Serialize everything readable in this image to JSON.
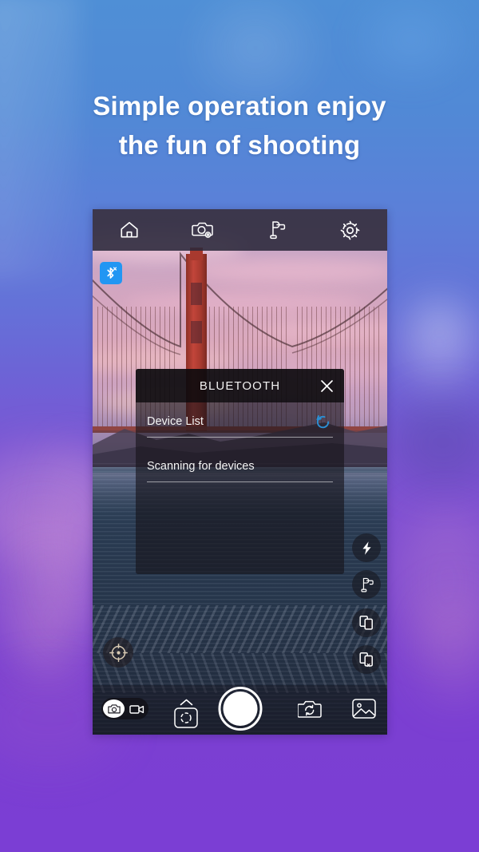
{
  "headline": {
    "line1": "Simple operation enjoy",
    "line2": "the fun of shooting"
  },
  "colors": {
    "banner_top": "#4f8fd6",
    "banner_bottom": "#7b3ed4",
    "bluetooth_blue": "#2196f3",
    "refresh_blue": "#2b8fd4",
    "toolbar_dark": "#2a283a",
    "text_white": "#ffffff"
  },
  "phone": {
    "topbar": {
      "items": [
        {
          "name": "home-icon",
          "label": "Home"
        },
        {
          "name": "camera-settings-icon",
          "label": "Camera Settings"
        },
        {
          "name": "gimbal-icon",
          "label": "Gimbal"
        },
        {
          "name": "settings-gear-icon",
          "label": "Settings"
        }
      ]
    },
    "bluetooth_badge": {
      "icon": "bluetooth-off-icon",
      "label": "Bluetooth Disconnected"
    },
    "dialog": {
      "title": "BLUETOOTH",
      "close_icon": "close-icon",
      "rows": [
        {
          "label": "Device List",
          "icon": "refresh-icon"
        },
        {
          "label": "Scanning for devices",
          "icon": ""
        }
      ]
    },
    "side_buttons": [
      {
        "name": "flash-icon",
        "label": "Flash"
      },
      {
        "name": "gimbal-control-icon",
        "label": "Gimbal Control"
      },
      {
        "name": "multi-device-icon",
        "label": "Multi Device"
      },
      {
        "name": "device-transfer-icon",
        "label": "Device Transfer"
      }
    ],
    "crosshair_button": {
      "name": "focus-target-icon",
      "label": "Target"
    },
    "bottombar": {
      "mode_toggle": {
        "photo": {
          "icon": "photo-camera-icon",
          "label": "Photo",
          "active": true
        },
        "video": {
          "icon": "video-camera-icon",
          "label": "Video",
          "active": false
        }
      },
      "focus_button": {
        "icon": "af-frame-icon",
        "label": "Focus"
      },
      "shutter_button": {
        "icon": "shutter-icon",
        "label": "Shutter"
      },
      "flip_button": {
        "icon": "flip-camera-icon",
        "label": "Flip Camera"
      },
      "gallery_button": {
        "icon": "gallery-icon",
        "label": "Gallery"
      }
    }
  }
}
